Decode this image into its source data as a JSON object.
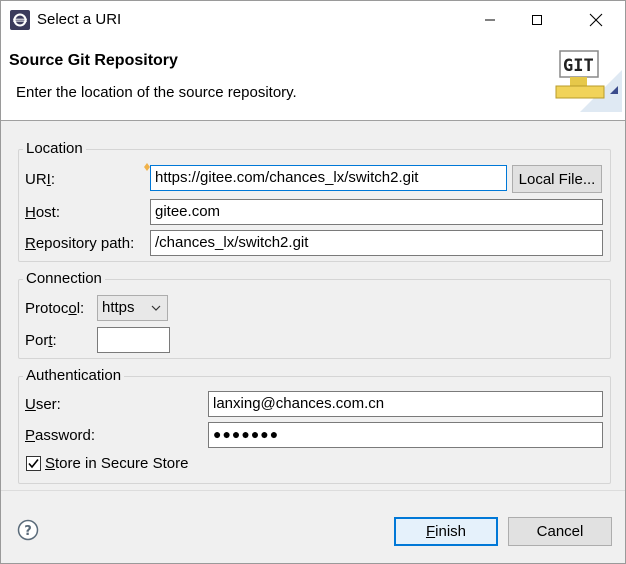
{
  "window": {
    "title": "Select a URI"
  },
  "header": {
    "title": "Source Git Repository",
    "description": "Enter the location of the source repository.",
    "banner_text": "GIT"
  },
  "location": {
    "group_label": "Location",
    "uri_label_pre": "UR",
    "uri_label_mn": "I",
    "uri_label_post": ":",
    "uri_value": "https://gitee.com/chances_lx/switch2.git",
    "local_file_button": "Local File...",
    "host_label_mn": "H",
    "host_label_post": "ost:",
    "host_value": "gitee.com",
    "repo_label_mn": "R",
    "repo_label_post": "epository path:",
    "repo_value": "/chances_lx/switch2.git"
  },
  "connection": {
    "group_label": "Connection",
    "protocol_label_pre": "Protoc",
    "protocol_label_mn": "o",
    "protocol_label_post": "l:",
    "protocol_value": "https",
    "port_label_pre": "Por",
    "port_label_mn": "t",
    "port_label_post": ":",
    "port_value": ""
  },
  "authentication": {
    "group_label": "Authentication",
    "user_label_mn": "U",
    "user_label_post": "ser:",
    "user_value": "lanxing@chances.com.cn",
    "password_label_mn": "P",
    "password_label_post": "assword:",
    "password_value": "●●●●●●●",
    "store_label_mn": "S",
    "store_label_post": "tore in Secure Store",
    "store_checked": true
  },
  "footer": {
    "finish_mn": "F",
    "finish_post": "inish",
    "cancel_label": "Cancel"
  },
  "colors": {
    "accent": "#0078d7",
    "background": "#f0f0f0"
  }
}
